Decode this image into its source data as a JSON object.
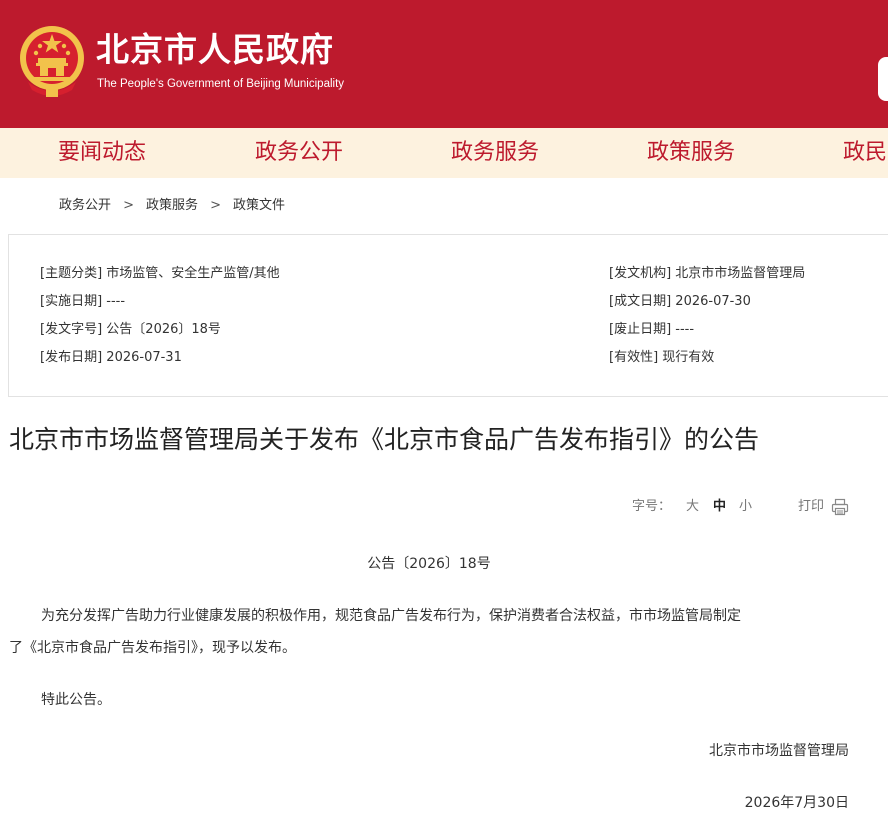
{
  "header": {
    "title": "北京市人民政府",
    "subtitle": "The People's Government of Beijing Municipality"
  },
  "nav": {
    "items": [
      "要闻动态",
      "政务公开",
      "政务服务",
      "政策服务",
      "政民"
    ]
  },
  "breadcrumb": {
    "items": [
      "政务公开",
      "政策服务",
      "政策文件"
    ],
    "separator": ">"
  },
  "meta": {
    "left": [
      {
        "label": "[主题分类]",
        "value": "市场监管、安全生产监管/其他"
      },
      {
        "label": "[实施日期]",
        "value": "----"
      },
      {
        "label": "[发文字号]",
        "value": "公告〔2026〕18号"
      },
      {
        "label": "[发布日期]",
        "value": "2026-07-31"
      }
    ],
    "right": [
      {
        "label": "[发文机构]",
        "value": "北京市市场监督管理局"
      },
      {
        "label": "[成文日期]",
        "value": "2026-07-30"
      },
      {
        "label": "[废止日期]",
        "value": "----"
      },
      {
        "label": "[有效性]",
        "value": "现行有效"
      }
    ]
  },
  "document": {
    "title": "北京市市场监督管理局关于发布《北京市食品广告发布指引》的公告",
    "font_size_label": "字号：",
    "font_size_options": [
      "大",
      "中",
      "小"
    ],
    "font_size_selected": "中",
    "print_label": "打印",
    "number": "公告〔2026〕18号",
    "paragraph1_line1": "为充分发挥广告助力行业健康发展的积极作用，规范食品广告发布行为，保护消费者合法权益，市市场监管局制定",
    "paragraph1_line2": "了《北京市食品广告发布指引》，现予以发布。",
    "paragraph2": "特此公告。",
    "signer": "北京市市场监督管理局",
    "date": "2026年7月30日"
  },
  "colors": {
    "brand_red": "#bd1a2d",
    "nav_bg": "#fdf2df",
    "emblem_gold": "#f2c24b"
  }
}
